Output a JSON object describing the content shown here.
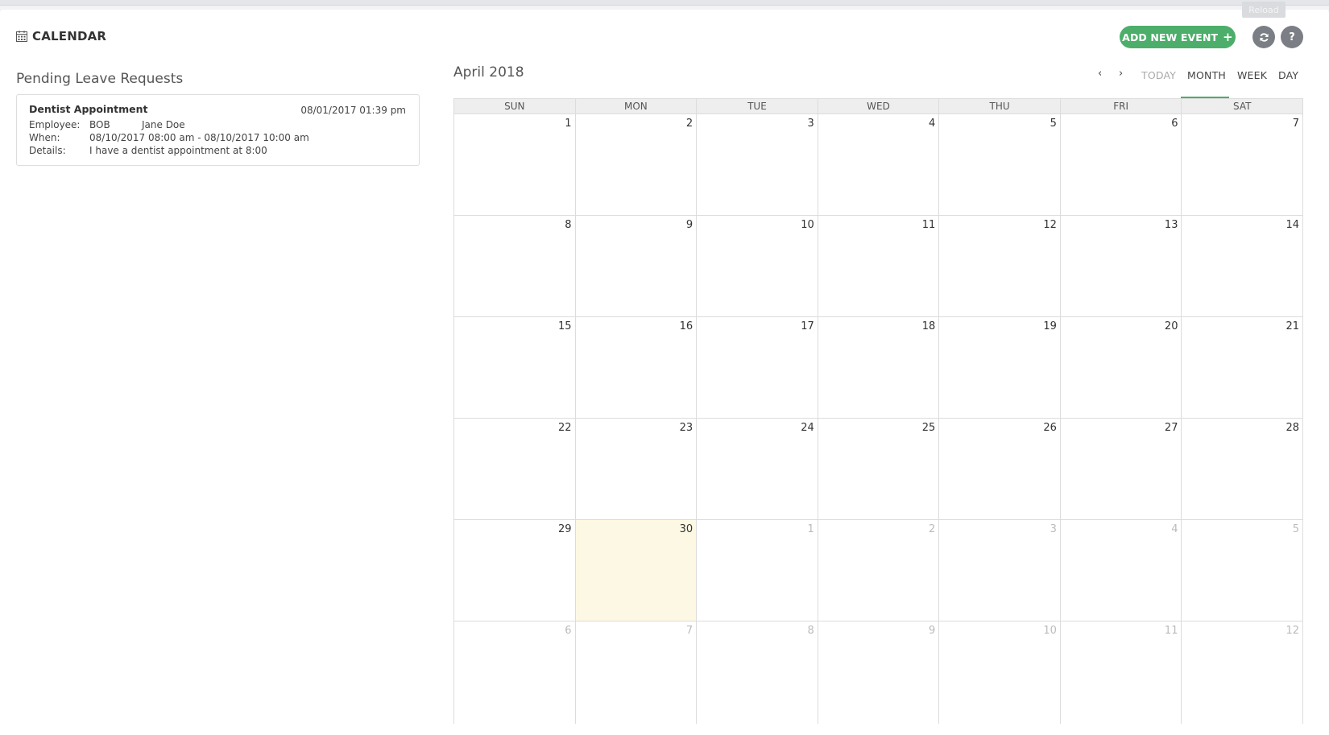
{
  "header": {
    "title": "CALENDAR",
    "add_button_label": "ADD NEW EVENT",
    "add_button_plus": "+",
    "reload_tooltip": "Reload",
    "help_label": "?",
    "accent_color": "#4cae6a"
  },
  "pending": {
    "title": "Pending Leave Requests",
    "requests": [
      {
        "name": "Dentist Appointment",
        "submitted": "08/01/2017 01:39 pm",
        "employee_label": "Employee:",
        "employee_code": "BOB",
        "employee_name": "Jane Doe",
        "when_label": "When:",
        "when": "08/10/2017 08:00 am - 08/10/2017 10:00 am",
        "details_label": "Details:",
        "details": "I have a dentist appointment at 8:00"
      }
    ]
  },
  "calendar": {
    "month_title": "April 2018",
    "nav_prev": "‹",
    "nav_next": "›",
    "tabs": {
      "today": "TODAY",
      "month": "MONTH",
      "week": "WEEK",
      "day": "DAY"
    },
    "active_tab": "month",
    "weekdays": [
      "SUN",
      "MON",
      "TUE",
      "WED",
      "THU",
      "FRI",
      "SAT"
    ],
    "weeks": [
      [
        {
          "d": "1"
        },
        {
          "d": "2"
        },
        {
          "d": "3"
        },
        {
          "d": "4"
        },
        {
          "d": "5"
        },
        {
          "d": "6"
        },
        {
          "d": "7"
        }
      ],
      [
        {
          "d": "8"
        },
        {
          "d": "9"
        },
        {
          "d": "10"
        },
        {
          "d": "11"
        },
        {
          "d": "12"
        },
        {
          "d": "13"
        },
        {
          "d": "14"
        }
      ],
      [
        {
          "d": "15"
        },
        {
          "d": "16"
        },
        {
          "d": "17"
        },
        {
          "d": "18"
        },
        {
          "d": "19"
        },
        {
          "d": "20"
        },
        {
          "d": "21"
        }
      ],
      [
        {
          "d": "22"
        },
        {
          "d": "23"
        },
        {
          "d": "24"
        },
        {
          "d": "25"
        },
        {
          "d": "26"
        },
        {
          "d": "27"
        },
        {
          "d": "28"
        }
      ],
      [
        {
          "d": "29"
        },
        {
          "d": "30",
          "today": true
        },
        {
          "d": "1",
          "other": true
        },
        {
          "d": "2",
          "other": true
        },
        {
          "d": "3",
          "other": true
        },
        {
          "d": "4",
          "other": true
        },
        {
          "d": "5",
          "other": true
        }
      ],
      [
        {
          "d": "6",
          "other": true
        },
        {
          "d": "7",
          "other": true
        },
        {
          "d": "8",
          "other": true
        },
        {
          "d": "9",
          "other": true
        },
        {
          "d": "10",
          "other": true
        },
        {
          "d": "11",
          "other": true
        },
        {
          "d": "12",
          "other": true
        }
      ]
    ]
  }
}
